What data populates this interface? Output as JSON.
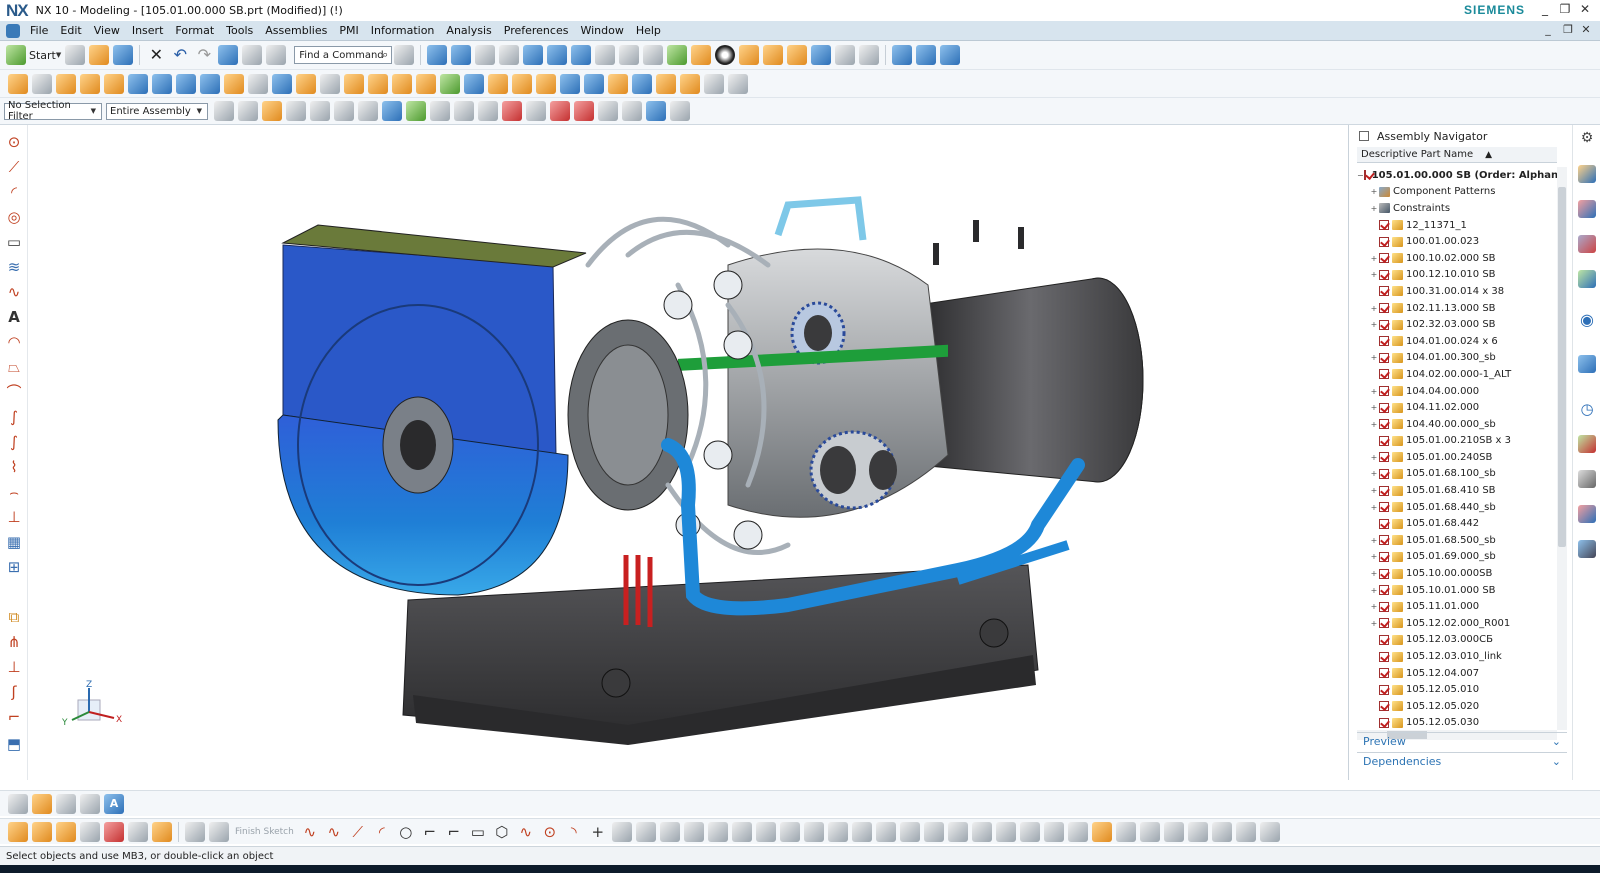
{
  "window": {
    "app_logo": "NX",
    "title": "NX 10 - Modeling - [105.01.00.000 SB.prt (Modified)]   (!)",
    "brand": "SIEMENS",
    "controls": [
      "_",
      "❐",
      "✕"
    ]
  },
  "menubar": {
    "items": [
      "File",
      "Edit",
      "View",
      "Insert",
      "Format",
      "Tools",
      "Assemblies",
      "PMI",
      "Information",
      "Analysis",
      "Preferences",
      "Window",
      "Help"
    ],
    "doc_controls": [
      "_",
      "❐",
      "✕"
    ]
  },
  "toolbar": {
    "start_label": "Start",
    "find_placeholder": "Find a Command",
    "selection_filter": "No Selection Filter",
    "assembly_scope": "Entire Assembly"
  },
  "assembly_navigator": {
    "title": "Assembly Navigator",
    "column": "Descriptive Part Name",
    "root": "105.01.00.000 SB (Order: Alphan",
    "groups": [
      "Component Patterns",
      "Constraints"
    ],
    "parts": [
      "12_11371_1",
      "100.01.00.023",
      "100.10.02.000 SB",
      "100.12.10.010 SB",
      "100.31.00.014 x 38",
      "102.11.13.000 SB",
      "102.32.03.000 SB",
      "104.01.00.024 x 6",
      "104.01.00.300_sb",
      "104.02.00.000-1_ALT",
      "104.04.00.000",
      "104.11.02.000",
      "104.40.00.000_sb",
      "105.01.00.210SB x 3",
      "105.01.00.240SB",
      "105.01.68.100_sb",
      "105.01.68.410 SB",
      "105.01.68.440_sb",
      "105.01.68.442",
      "105.01.68.500_sb",
      "105.01.69.000_sb",
      "105.10.00.000SB",
      "105.10.01.000 SB",
      "105.11.01.000",
      "105.12.02.000_R001",
      "105.12.03.000СБ",
      "105.12.03.010_link",
      "105.12.04.007",
      "105.12.05.010",
      "105.12.05.020",
      "105.12.05.030"
    ],
    "preview_label": "Preview",
    "dependencies_label": "Dependencies"
  },
  "bottom_toolbar": {
    "finish_sketch": "Finish Sketch"
  },
  "status": {
    "message": "Select objects and use MB3, or double-click an object"
  },
  "triad": {
    "x": "X",
    "y": "Y",
    "z": "Z"
  },
  "colors": {
    "menubar": "#d7e4ee",
    "accent": "#2d74b4",
    "casing_blue": "#2b66d0",
    "steel_gray": "#8a8e92",
    "base_dark": "#3a3a3c"
  }
}
